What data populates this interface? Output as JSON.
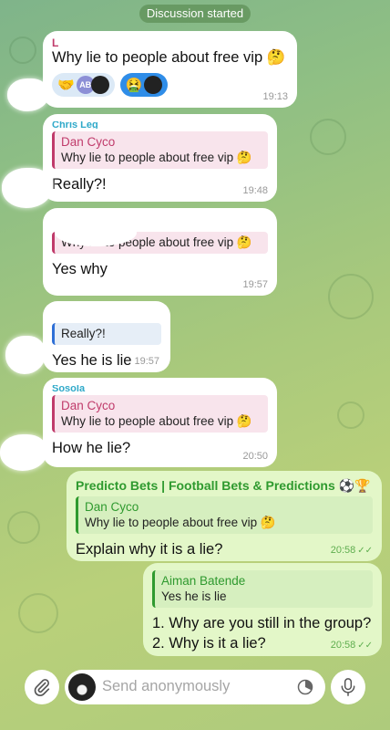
{
  "banner": "Discussion started",
  "messages": [
    {
      "sender": "L",
      "text": "Why lie to people about free vip 🤔",
      "time": "19:13",
      "reactions": [
        {
          "emoji": "🤝",
          "avatars": [
            "AB",
            ""
          ]
        },
        {
          "emoji": "🤮",
          "avatars": [
            ""
          ]
        }
      ]
    },
    {
      "sender": "Chris Leg",
      "quote": {
        "name": "Dan Cyco",
        "text": "Why lie to people about free vip 🤔"
      },
      "text": "Really?!",
      "time": "19:48"
    },
    {
      "quote": {
        "text": "Why lie to people about free vip 🤔"
      },
      "text": "Yes why",
      "time": "19:57"
    },
    {
      "quote": {
        "text": "Really?!"
      },
      "text": "Yes he is lie",
      "time": "19:57"
    },
    {
      "sender": "Sosola",
      "quote": {
        "name": "Dan Cyco",
        "text": "Why lie to people about free vip 🤔"
      },
      "text": "How he lie?",
      "time": "20:50"
    },
    {
      "sender": "Predicto Bets | Football Bets & Predictions ⚽🏆",
      "quote": {
        "name": "Dan Cyco",
        "text": "Why lie to people about free vip 🤔"
      },
      "text": "Explain why it is a lie?",
      "time": "20:58"
    },
    {
      "quote": {
        "name": "Aiman Batende",
        "text": "Yes he is lie"
      },
      "lines": [
        "1. Why are you still in the group?",
        "2. Why is it a lie?"
      ],
      "time": "20:58"
    }
  ],
  "input": {
    "placeholder": "Send anonymously",
    "attach_icon": "paperclip-icon",
    "timer_icon": "timer-icon",
    "mic_icon": "microphone-icon"
  },
  "colors": {
    "incoming_bubble": "#ffffff",
    "outgoing_bubble": "#e3f7c8",
    "quote_accent": "#c03b6b",
    "outgoing_accent": "#2f9a2f",
    "time_outgoing": "#5fae4f"
  }
}
